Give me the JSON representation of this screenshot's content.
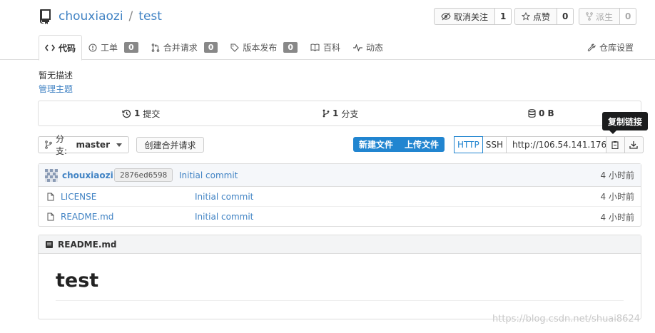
{
  "repo": {
    "owner": "chouxiaozi",
    "separator": "/",
    "name": "test"
  },
  "actions": [
    {
      "label": "取消关注",
      "count": "1",
      "icon": "eye-slash-icon"
    },
    {
      "label": "点赞",
      "count": "0",
      "icon": "star-icon"
    },
    {
      "label": "派生",
      "count": "0",
      "icon": "fork-icon"
    }
  ],
  "tabs": [
    {
      "label": "代码",
      "icon": "code-icon"
    },
    {
      "label": "工单",
      "count": "0",
      "icon": "issue-icon"
    },
    {
      "label": "合并请求",
      "count": "0",
      "icon": "pull-request-icon"
    },
    {
      "label": "版本发布",
      "count": "0",
      "icon": "tag-icon"
    },
    {
      "label": "百科",
      "icon": "book-icon"
    },
    {
      "label": "动态",
      "icon": "pulse-icon"
    }
  ],
  "settings_tab": "仓库设置",
  "description": "暂无描述",
  "manage_topics": "管理主题",
  "stats": {
    "commits": {
      "value": "1",
      "label": "提交"
    },
    "branches": {
      "value": "1",
      "label": "分支"
    },
    "size": {
      "value": "0 B"
    }
  },
  "branch": {
    "prefix": "分支:",
    "name": "master"
  },
  "new_pr_label": "创建合并请求",
  "new_file_label": "新建文件",
  "upload_file_label": "上传文件",
  "clone": {
    "http": "HTTP",
    "ssh": "SSH",
    "url": "http://106.54.141.176"
  },
  "tooltip": "复制链接",
  "latest_commit": {
    "author": "chouxiaozi",
    "sha": "2876ed6598",
    "message": "Initial commit",
    "time": "4 小时前"
  },
  "files": [
    {
      "name": "LICENSE",
      "message": "Initial commit",
      "time": "4 小时前"
    },
    {
      "name": "README.md",
      "message": "Initial commit",
      "time": "4 小时前"
    }
  ],
  "readme": {
    "filename": "README.md",
    "heading": "test"
  },
  "watermark": "https://blog.csdn.net/shuai8624",
  "colors": {
    "link": "#4183c4",
    "primary": "#2185d0",
    "tooltip_bg": "#1b1c1d"
  }
}
